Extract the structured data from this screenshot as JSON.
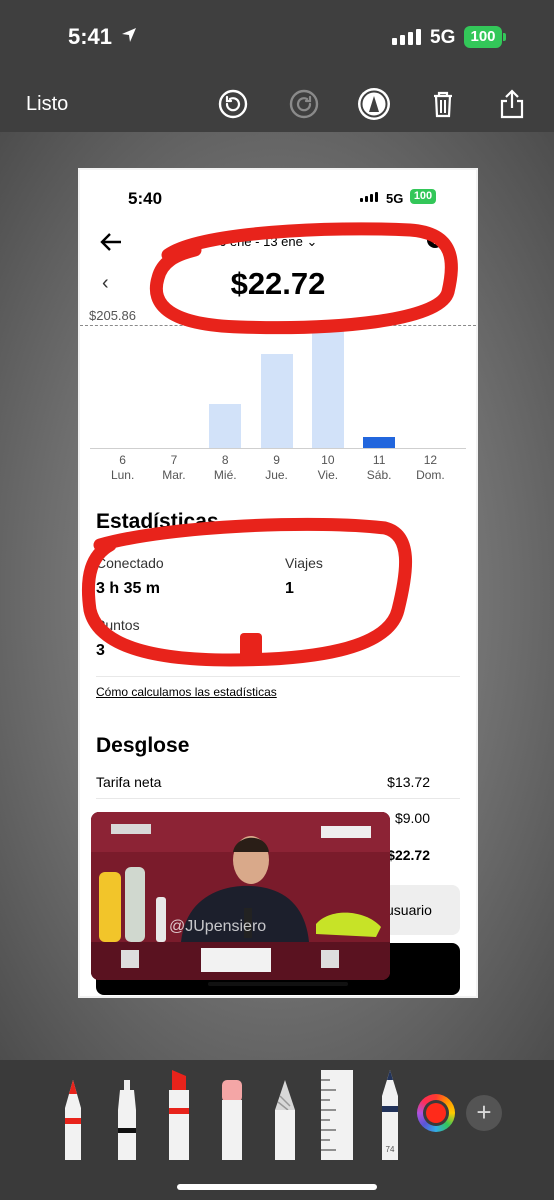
{
  "status_bar": {
    "time": "5:41",
    "network": "5G",
    "battery": "100"
  },
  "toolbar": {
    "done_label": "Listo",
    "icons": [
      "undo-icon",
      "redo-icon",
      "markup-pen-icon",
      "trash-icon",
      "share-icon"
    ]
  },
  "screenshot": {
    "status": {
      "time": "5:40",
      "network": "5G",
      "battery": "100"
    },
    "header": {
      "date_range": "6 ene - 13 ene",
      "help": "?"
    },
    "amount": "$22.72",
    "max_label": "$205.86",
    "chart_data": {
      "type": "bar",
      "days": [
        "6",
        "7",
        "8",
        "9",
        "10",
        "11",
        "12"
      ],
      "weekday_labels": [
        "Lun.",
        "Mar.",
        "Mié.",
        "Jue.",
        "Vie.",
        "Sáb.",
        "Dom."
      ],
      "values": [
        0,
        0,
        90,
        193,
        253,
        22.72,
        0
      ],
      "ylim": [
        0,
        260
      ],
      "reference_line": 205.86,
      "selected": 5
    },
    "stats": {
      "title": "Estadísticas",
      "online_label": "Conectado",
      "online_value": "3 h 35 m",
      "trips_label": "Viajes",
      "trips_value": "1",
      "points_label": "Puntos",
      "points_value": "3",
      "link": "Cómo calculamos las estadísticas"
    },
    "breakdown": {
      "title": "Desglose",
      "rows": [
        {
          "label": "Tarifa neta",
          "value": "$13.72"
        },
        {
          "label": "",
          "value": "$9.00"
        },
        {
          "label": "",
          "value": "$22.72"
        }
      ],
      "grey_button": "usuario"
    },
    "video_watermark": "@JUpensiero"
  },
  "colors": {
    "annotation": "#e8231b",
    "bar": "#d2e2f9",
    "bar_selected": "#2266dd",
    "battery": "#33c759"
  }
}
